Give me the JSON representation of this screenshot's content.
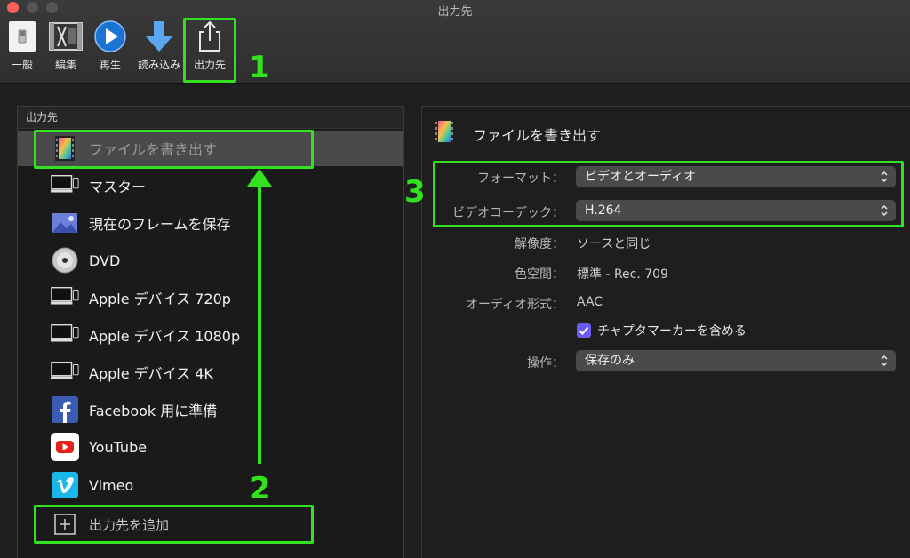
{
  "window": {
    "title": "出力先"
  },
  "toolbar": {
    "items": [
      {
        "label": "一般"
      },
      {
        "label": "編集"
      },
      {
        "label": "再生"
      },
      {
        "label": "読み込み"
      },
      {
        "label": "出力先"
      }
    ]
  },
  "annotations": {
    "step1": "1",
    "step2": "2",
    "step3": "3",
    "highlight_color": "#33e21f"
  },
  "left_panel": {
    "header": "出力先",
    "items": [
      {
        "label": "ファイルを書き出す",
        "icon": "film-icon",
        "selected": true
      },
      {
        "label": "マスター",
        "icon": "computer-devices-icon"
      },
      {
        "label": "現在のフレームを保存",
        "icon": "image-icon"
      },
      {
        "label": "DVD",
        "icon": "disc-icon"
      },
      {
        "label": "Apple デバイス 720p",
        "icon": "computer-devices-icon"
      },
      {
        "label": "Apple デバイス 1080p",
        "icon": "computer-devices-icon"
      },
      {
        "label": "Apple デバイス 4K",
        "icon": "computer-devices-icon"
      },
      {
        "label": "Facebook 用に準備",
        "icon": "facebook-icon"
      },
      {
        "label": "YouTube",
        "icon": "youtube-icon"
      },
      {
        "label": "Vimeo",
        "icon": "vimeo-icon"
      }
    ],
    "add_label": "出力先を追加"
  },
  "right_panel": {
    "title": "ファイルを書き出す",
    "format_label": "フォーマット：",
    "format_value": "ビデオとオーディオ",
    "codec_label": "ビデオコーデック：",
    "codec_value": "H.264",
    "resolution_label": "解像度：",
    "resolution_value": "ソースと同じ",
    "colorspace_label": "色空間：",
    "colorspace_value": "標準 - Rec. 709",
    "audio_label": "オーディオ形式：",
    "audio_value": "AAC",
    "chapter_label": "チャプタマーカーを含める",
    "chapter_checked": true,
    "action_label": "操作：",
    "action_value": "保存のみ"
  },
  "colors": {
    "accent_checkbox": "#6a5cf0",
    "selected_row": "#4a4a4a"
  }
}
